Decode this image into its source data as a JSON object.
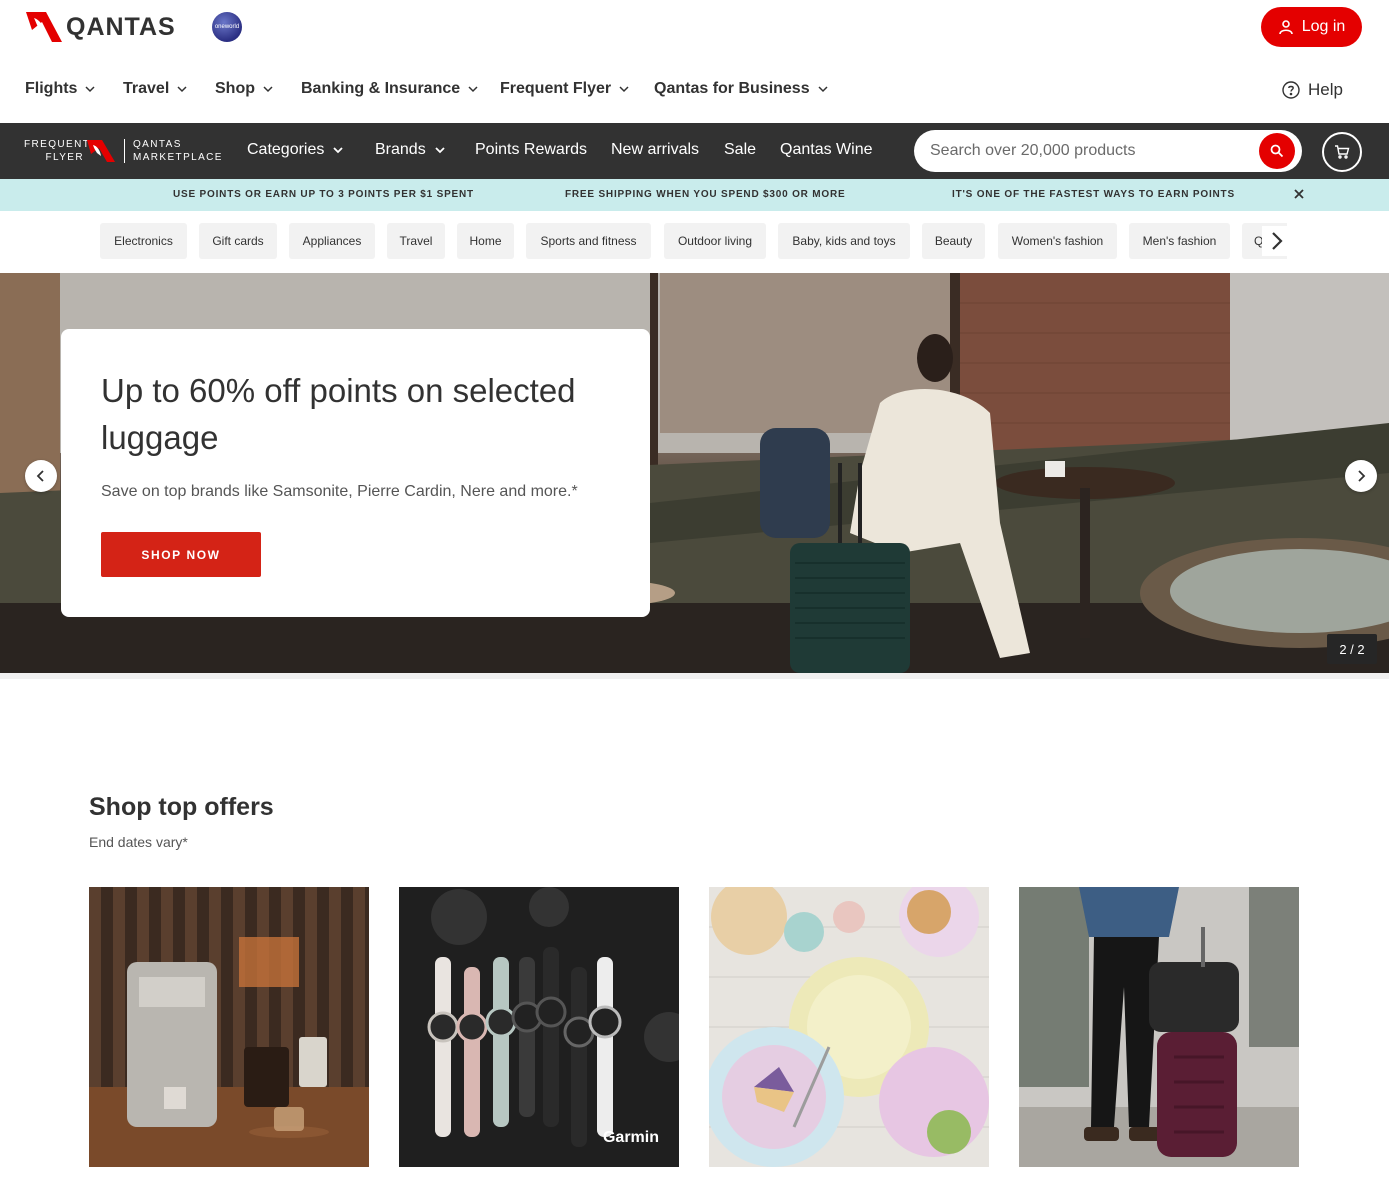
{
  "header": {
    "brand": "QANTAS",
    "alliance": "oneworld",
    "login_label": "Log in"
  },
  "main_nav": {
    "items": [
      {
        "label": "Flights"
      },
      {
        "label": "Travel"
      },
      {
        "label": "Shop"
      },
      {
        "label": "Banking & Insurance"
      },
      {
        "label": "Frequent Flyer"
      },
      {
        "label": "Qantas for Business"
      }
    ],
    "help_label": "Help"
  },
  "marketplace": {
    "logo_left_line1": "FREQUENT",
    "logo_left_line2": "FLYER",
    "logo_right_line1": "QANTAS",
    "logo_right_line2": "MARKETPLACE",
    "nav": [
      {
        "label": "Categories"
      },
      {
        "label": "Brands"
      },
      {
        "label": "Points Rewards"
      },
      {
        "label": "New arrivals"
      },
      {
        "label": "Sale"
      },
      {
        "label": "Qantas Wine"
      }
    ],
    "search_placeholder": "Search over 20,000 products"
  },
  "promo_strip": {
    "messages": [
      "USE POINTS OR EARN UP TO 3 POINTS PER $1 SPENT",
      "FREE SHIPPING WHEN YOU SPEND $300 OR MORE",
      "IT'S ONE OF THE FASTEST WAYS TO EARN POINTS"
    ]
  },
  "categories": [
    "Electronics",
    "Gift cards",
    "Appliances",
    "Travel",
    "Home",
    "Sports and fitness",
    "Outdoor living",
    "Baby, kids and toys",
    "Beauty",
    "Women's fashion",
    "Men's fashion",
    "Qantas"
  ],
  "hero": {
    "title": "Up to 60% off points on selected luggage",
    "subtitle": "Save on top brands like Samsonite, Pierre Cardin, Nere and more.*",
    "cta": "SHOP NOW",
    "slide_counter": "2 / 2"
  },
  "offers": {
    "title": "Shop top offers",
    "subtitle": "End dates vary*",
    "tiles": [
      {
        "image": "coffee-machine"
      },
      {
        "image": "smartwatches",
        "brand": "Garmin"
      },
      {
        "image": "tableware"
      },
      {
        "image": "luggage"
      }
    ]
  },
  "colors": {
    "brand_red": "#e40000",
    "dark_bar": "#323232",
    "promo_bg": "#c9ecec"
  }
}
